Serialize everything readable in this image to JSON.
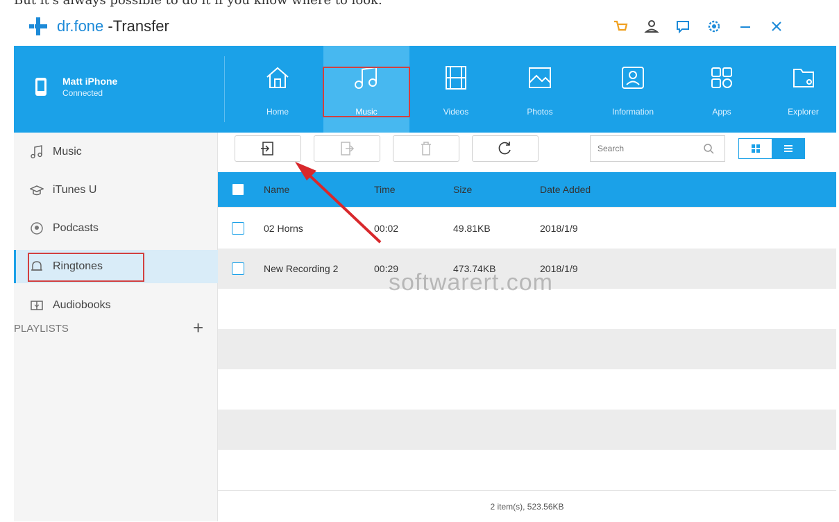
{
  "caption": "But it's always possible to do it if you know where to look.",
  "app": {
    "brand": "dr.fone",
    "suffix": " -Transfer"
  },
  "device": {
    "name": "Matt iPhone",
    "status": "Connected"
  },
  "nav": [
    {
      "label": "Home",
      "icon": "home-icon"
    },
    {
      "label": "Music",
      "icon": "music-icon"
    },
    {
      "label": "Videos",
      "icon": "film-icon"
    },
    {
      "label": "Photos",
      "icon": "image-icon"
    },
    {
      "label": "Information",
      "icon": "contact-icon"
    },
    {
      "label": "Apps",
      "icon": "apps-grid-icon"
    },
    {
      "label": "Explorer",
      "icon": "folder-icon"
    }
  ],
  "sidebar": {
    "items": [
      {
        "label": "Music",
        "icon": "music-note-icon"
      },
      {
        "label": "iTunes U",
        "icon": "graduation-cap-icon"
      },
      {
        "label": "Podcasts",
        "icon": "podcast-icon"
      },
      {
        "label": "Ringtones",
        "icon": "bell-icon"
      },
      {
        "label": "Audiobooks",
        "icon": "book-icon"
      }
    ],
    "playlists_label": "PLAYLISTS",
    "add_label": "+"
  },
  "toolbar": {
    "search_placeholder": "Search",
    "refresh": "C"
  },
  "table": {
    "columns": [
      "Name",
      "Time",
      "Size",
      "Date Added"
    ],
    "rows": [
      [
        "02 Horns",
        "00:02",
        "49.81KB",
        "2018/1/9"
      ],
      [
        "New Recording 2",
        "00:29",
        "473.74KB",
        "2018/1/9"
      ]
    ]
  },
  "watermark": "softwarert.com",
  "status": "2 item(s), 523.56KB",
  "colors": {
    "accent": "#1ba1e8",
    "highlight": "#d24040"
  }
}
